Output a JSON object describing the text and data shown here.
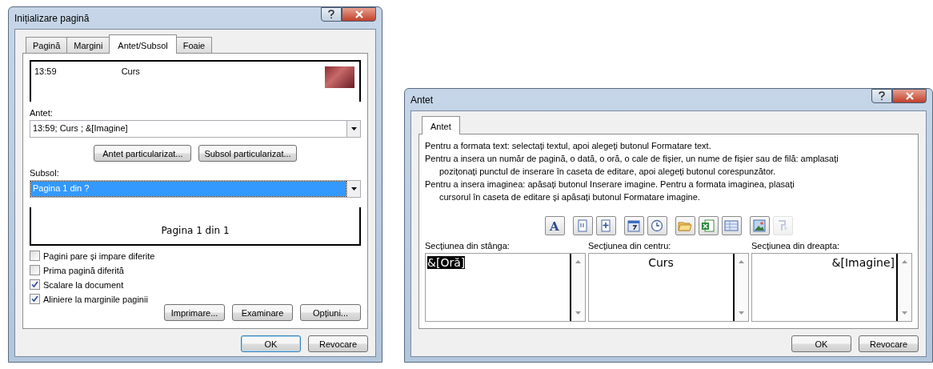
{
  "page_setup": {
    "title": "Inițializare pagină",
    "tabs": [
      {
        "label": "Pagină",
        "selected": false
      },
      {
        "label": "Margini",
        "selected": false
      },
      {
        "label": "Antet/Subsol",
        "selected": true
      },
      {
        "label": "Foaie",
        "selected": false
      }
    ],
    "header_preview": {
      "left": "13:59",
      "center": "Curs"
    },
    "header_label": "Antet:",
    "header_value": "13:59; Curs ; &[Imagine]",
    "custom_buttons": [
      "Antet particularizat...",
      "Subsol particularizat..."
    ],
    "footer_label": "Subsol:",
    "footer_value": "Pagina 1 din ?",
    "footer_value_selected": true,
    "footer_preview": "Pagina 1 din 1",
    "options": [
      {
        "label": "Pagini pare și impare diferite",
        "checked": false
      },
      {
        "label": "Prima pagină diferită",
        "checked": false
      },
      {
        "label": "Scalare la document",
        "checked": true
      },
      {
        "label": "Aliniere la marginile paginii",
        "checked": true
      }
    ],
    "action_buttons": [
      "Imprimare...",
      "Examinare",
      "Opțiuni..."
    ],
    "buttons": [
      "OK",
      "Revocare"
    ]
  },
  "header_dialog": {
    "title": "Antet",
    "tabs": [
      {
        "label": "Antet",
        "selected": true
      }
    ],
    "instructions": [
      {
        "text": "Pentru a formata text: selectați textul, apoi alegeți butonul Formatare text.",
        "indented": false
      },
      {
        "text": "Pentru a insera un număr de pagină, o dată, o oră, o cale de fișier, un nume de fișier sau de filă: amplasați",
        "indented": false
      },
      {
        "text": "pozițonați punctul de inserare în caseta de editare, apoi alegeți butonul corespunzător.",
        "indented": true
      },
      {
        "text": "Pentru a insera imaginea: apăsați butonul Inserare imagine. Pentru a formata imaginea, plasați",
        "indented": false
      },
      {
        "text": "cursorul în caseta de editare și apăsați butonul Formatare imagine.",
        "indented": true
      }
    ],
    "toolbar": [
      [
        {
          "kind": "font",
          "label": "A",
          "disabled": false
        }
      ],
      [
        {
          "kind": "page-number",
          "disabled": false
        },
        {
          "kind": "page-count",
          "disabled": false
        }
      ],
      [
        {
          "kind": "date",
          "disabled": false
        },
        {
          "kind": "time",
          "disabled": false
        }
      ],
      [
        {
          "kind": "folder",
          "disabled": false
        },
        {
          "kind": "workbook",
          "disabled": false
        },
        {
          "kind": "sheet",
          "disabled": false
        }
      ],
      [
        {
          "kind": "picture",
          "disabled": false
        },
        {
          "kind": "format-picture",
          "disabled": true
        }
      ]
    ],
    "sections": [
      {
        "label": "Secțiunea din stânga:",
        "text": "&[Oră]",
        "text_selected": true
      },
      {
        "label": "Secțiunea din centru:",
        "text": "Curs",
        "text_selected": false
      },
      {
        "label": "Secțiunea din dreapta:",
        "text": "&[Imagine]",
        "text_selected": false
      }
    ],
    "buttons": [
      "OK",
      "Revocare"
    ]
  }
}
